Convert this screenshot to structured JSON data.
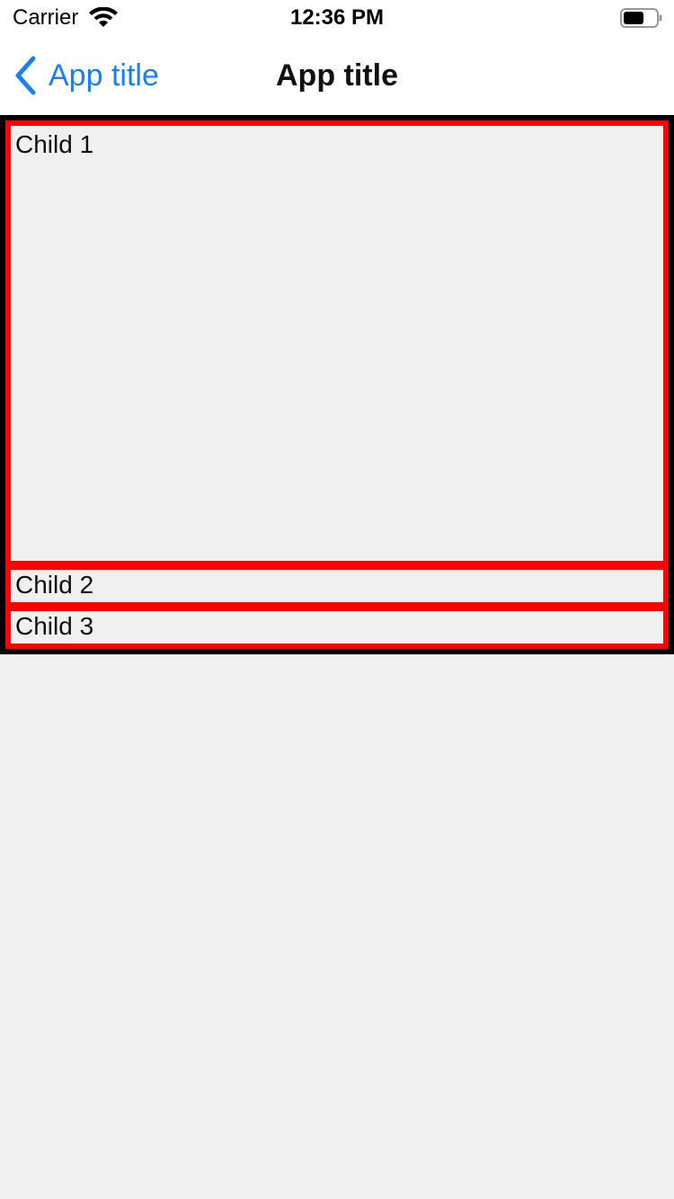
{
  "status_bar": {
    "carrier": "Carrier",
    "time": "12:36 PM",
    "wifi_icon": "wifi-icon",
    "battery_icon": "battery-icon"
  },
  "nav_bar": {
    "back_label": "App title",
    "title": "App title",
    "back_icon": "chevron-left-icon",
    "accent_color": "#1a7ff5"
  },
  "content": {
    "children": [
      {
        "label": "Child 1"
      },
      {
        "label": "Child 2"
      },
      {
        "label": "Child 3"
      }
    ],
    "colors": {
      "outer_border": "#000000",
      "child_border": "#ff0000",
      "background": "#f0f0f0"
    }
  }
}
